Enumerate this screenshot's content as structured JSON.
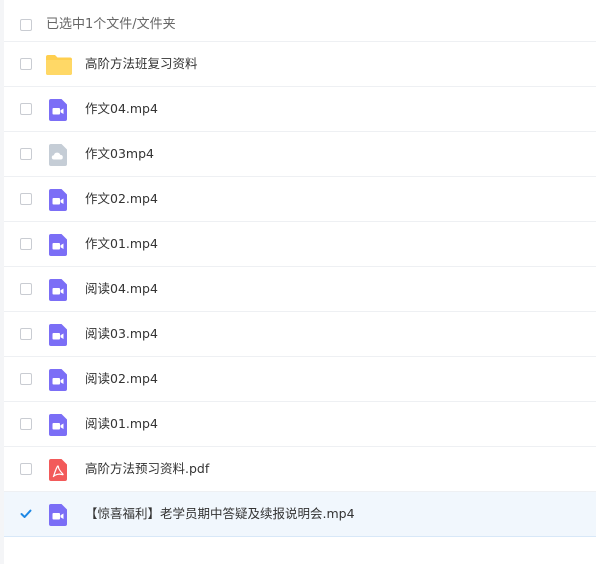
{
  "header": {
    "select_label": "已选中1个文件/文件夹"
  },
  "files": [
    {
      "name": "高阶方法班复习资料",
      "icon": "folder-icon",
      "selected": false
    },
    {
      "name": "作文04.mp4",
      "icon": "video-icon",
      "selected": false
    },
    {
      "name": "作文03mp4",
      "icon": "cloud-file-icon",
      "selected": false
    },
    {
      "name": "作文02.mp4",
      "icon": "video-icon",
      "selected": false
    },
    {
      "name": "作文01.mp4",
      "icon": "video-icon",
      "selected": false
    },
    {
      "name": "阅读04.mp4",
      "icon": "video-icon",
      "selected": false
    },
    {
      "name": "阅读03.mp4",
      "icon": "video-icon",
      "selected": false
    },
    {
      "name": "阅读02.mp4",
      "icon": "video-icon",
      "selected": false
    },
    {
      "name": "阅读01.mp4",
      "icon": "video-icon",
      "selected": false
    },
    {
      "name": "高阶方法预习资料.pdf",
      "icon": "pdf-icon",
      "selected": false
    },
    {
      "name": "【惊喜福利】老学员期中答疑及续报说明会.mp4",
      "icon": "video-icon",
      "selected": true
    }
  ],
  "colors": {
    "video_icon": "#7b6ef6",
    "folder_icon": "#ffd15c",
    "pdf_icon": "#f25a5a",
    "cloud_file_icon": "#c5cdd6",
    "checkbox_checked": "#1e88e5",
    "selected_row_bg": "#f1f7fd"
  }
}
